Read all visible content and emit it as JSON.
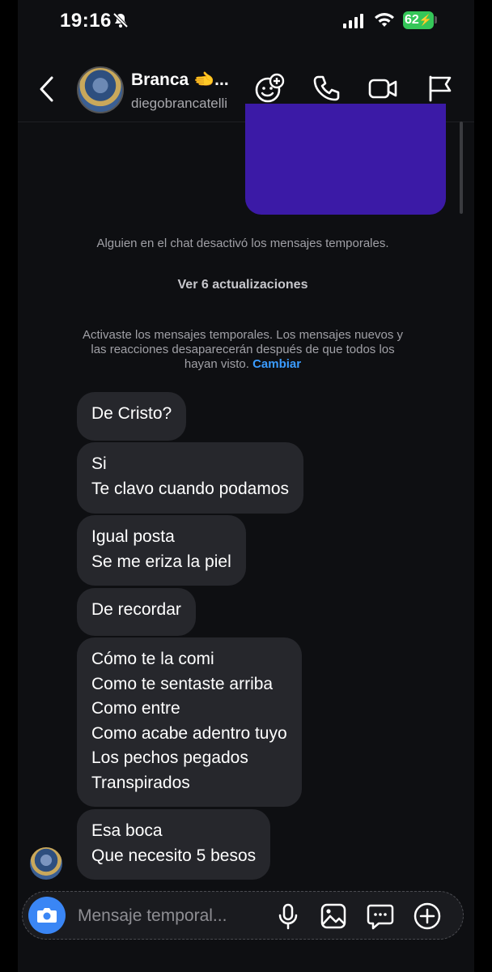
{
  "status_bar": {
    "time": "19:16",
    "battery": "62"
  },
  "header": {
    "name": "Branca 🫲...",
    "username": "diegobrancatelli"
  },
  "system": {
    "disabled_notice": "Alguien en el chat desactivó los mensajes temporales.",
    "updates": "Ver 6 actualizaciones",
    "activated_line1": "Activaste los mensajes temporales. Los mensajes nuevos y",
    "activated_line2": "las reacciones desaparecerán después de que todos los",
    "activated_line3": "hayan visto.",
    "change_link": "Cambiar"
  },
  "messages": [
    {
      "lines": [
        "De Cristo?"
      ]
    },
    {
      "lines": [
        "Si",
        "Te clavo cuando podamos"
      ]
    },
    {
      "lines": [
        "Igual posta",
        "Se me eriza la piel"
      ]
    },
    {
      "lines": [
        "De recordar"
      ]
    },
    {
      "lines": [
        "Cómo te la comi",
        "Como te sentaste arriba",
        "Como entre",
        "Como acabe adentro tuyo",
        "Los pechos pegados",
        "Transpirados"
      ]
    },
    {
      "lines": [
        "Esa boca",
        "Que necesito 5 besos"
      ]
    }
  ],
  "composer": {
    "placeholder": "Mensaje temporal..."
  },
  "colors": {
    "accent": "#3a86f5",
    "link": "#3b9cff",
    "incoming_bubble": "#26272c",
    "media_bubble": "#3b1aa6",
    "battery": "#35c759"
  },
  "icons": [
    "bell-slash-icon",
    "signal-icon",
    "wifi-icon",
    "back-arrow-icon",
    "sticker-add-icon",
    "phone-icon",
    "video-icon",
    "flag-icon",
    "camera-icon",
    "microphone-icon",
    "image-icon",
    "chat-bubble-icon",
    "plus-icon"
  ]
}
